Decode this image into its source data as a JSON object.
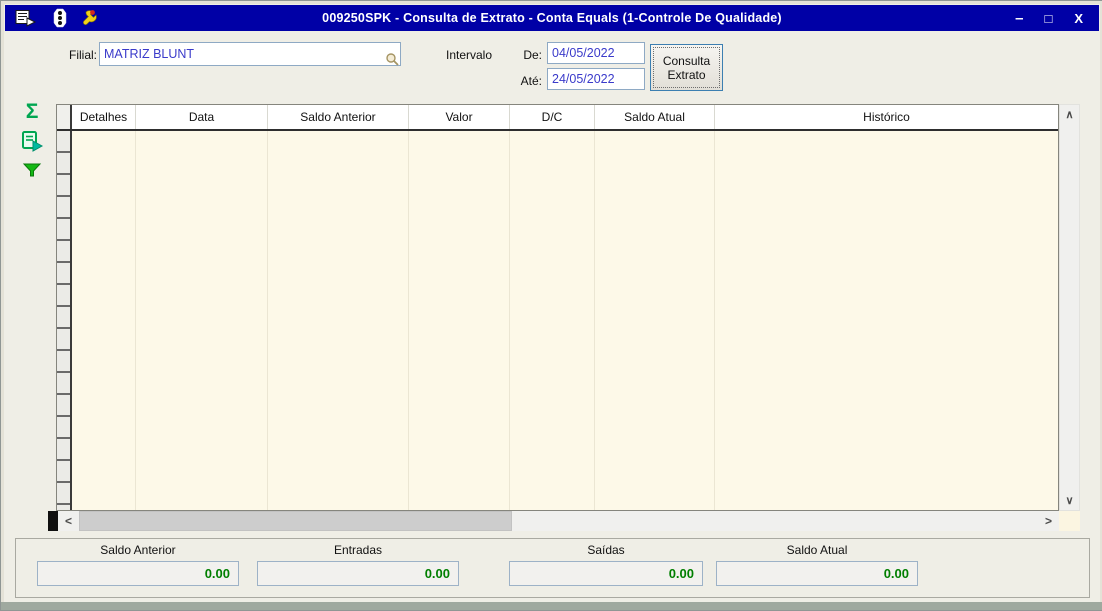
{
  "window": {
    "title": "009250SPK - Consulta de Extrato - Conta Equals (1-Controle De Qualidade)",
    "controls": {
      "minimize": "–",
      "maximize": "□",
      "close": "X"
    }
  },
  "form": {
    "filial_label": "Filial:",
    "filial_value": "MATRIZ BLUNT",
    "intervalo_label": "Intervalo",
    "de_label": "De:",
    "de_value": "04/05/2022",
    "ate_label": "Até:",
    "ate_value": "24/05/2022",
    "button_line1": "Consulta",
    "button_line2": "Extrato"
  },
  "sidebar": {
    "sigma_glyph": "Σ"
  },
  "table": {
    "columns": [
      "Detalhes",
      "Data",
      "Saldo Anterior",
      "Valor",
      "D/C",
      "Saldo Atual",
      "Histórico"
    ],
    "rows": []
  },
  "scrollbar": {
    "up": "∧",
    "down": "∨",
    "left": "<",
    "right": ">"
  },
  "summary": {
    "fields": [
      {
        "label": "Saldo Anterior",
        "value": "0.00"
      },
      {
        "label": "Entradas",
        "value": "0.00"
      },
      {
        "label": "Saídas",
        "value": "0.00"
      },
      {
        "label": "Saldo Atual",
        "value": "0.00"
      }
    ]
  },
  "colors": {
    "titlebar": "#0000A6",
    "accent_green": "#00A651",
    "value_green": "#007F00",
    "input_text": "#3A3ACA",
    "grid_bg": "#FDF9E8"
  }
}
